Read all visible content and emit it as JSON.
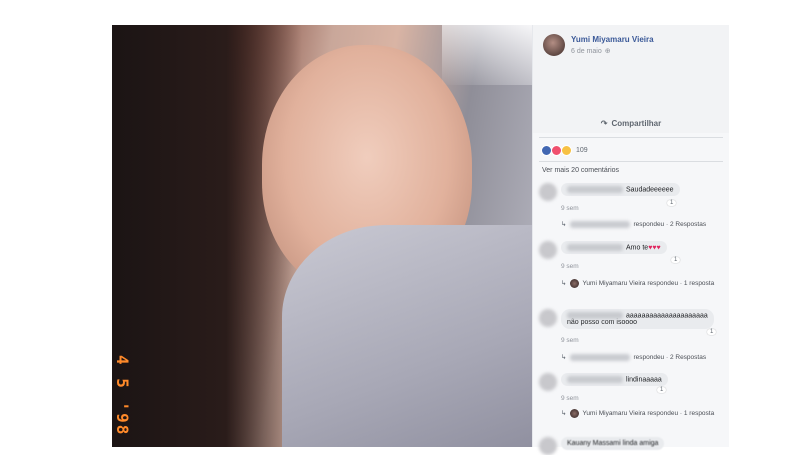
{
  "post": {
    "author": "Yumi Miyamaru Vieira",
    "time": "6 de maio",
    "photo_date": "4 5 '98",
    "share_label": "Compartilhar",
    "reaction_count": "109",
    "more_comments": "Ver mais 20 comentários"
  },
  "comments": [
    {
      "text": "Saudadeeeeee",
      "time": "9 sem",
      "badge": "1",
      "reply": "respondeu · 2 Respostas"
    },
    {
      "text": "Amo te",
      "hearts": "♥♥♥",
      "time": "9 sem",
      "badge": "1",
      "reply_author": "Yumi Miyamaru Vieira",
      "reply": "respondeu · 1 resposta"
    },
    {
      "text": "aaaaaaaaaaaaaaaaaaaaa",
      "text2": "não posso com isoooo",
      "time": "9 sem",
      "badge": "1",
      "reply": "respondeu · 2 Respostas"
    },
    {
      "text": "lindinaaaaa",
      "time": "9 sem",
      "badge": "1",
      "reply_author": "Yumi Miyamaru Vieira",
      "reply": "respondeu · 1 resposta"
    },
    {
      "text": "Kauany Massami linda amiga"
    }
  ]
}
